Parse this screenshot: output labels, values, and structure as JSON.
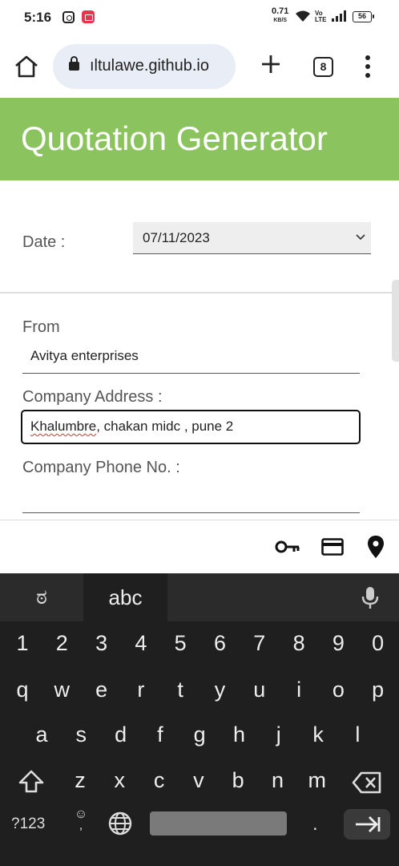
{
  "status_bar": {
    "time": "5:16",
    "net_speed": "0.71",
    "net_unit": "KB/S",
    "volte": "Vo LTE",
    "battery": "56"
  },
  "browser": {
    "url": "ıltulawe.github.io",
    "tab_count": "8"
  },
  "page": {
    "title": "Quotation Generator",
    "date_label": "Date :",
    "date_value": "07/11/2023",
    "from_label": "From",
    "from_value": "Avitya enterprises",
    "address_label": "Company Address :",
    "address_misspelled": "Khalumbre",
    "address_rest": ", chakan midc , pune 2",
    "phone_label": "Company Phone No. :"
  },
  "keyboard": {
    "lang_tab": "ಠ",
    "abc_tab": "abc",
    "number_row": [
      "1",
      "2",
      "3",
      "4",
      "5",
      "6",
      "7",
      "8",
      "9",
      "0"
    ],
    "row1": [
      "q",
      "w",
      "e",
      "r",
      "t",
      "y",
      "u",
      "i",
      "o",
      "p"
    ],
    "row2": [
      "a",
      "s",
      "d",
      "f",
      "g",
      "h",
      "j",
      "k",
      "l"
    ],
    "row3": [
      "z",
      "x",
      "c",
      "v",
      "b",
      "n",
      "m"
    ],
    "symbols_key": "?123",
    "emoji_comma": ",",
    "period_key": "."
  },
  "colors": {
    "banner": "#8bc45e",
    "keyboard_bg": "#1f1f1f",
    "url_bg": "#e9eef6"
  },
  "icons": [
    "instagram-icon",
    "screen-record-icon",
    "wifi-icon",
    "signal-icon",
    "battery-icon",
    "home-icon",
    "lock-icon",
    "plus-icon",
    "tabs-icon",
    "more-vert-icon",
    "chevron-down-icon",
    "key-icon",
    "credit-card-icon",
    "location-pin-icon",
    "mic-icon",
    "shift-icon",
    "backspace-icon",
    "emoji-icon",
    "globe-icon",
    "enter-icon"
  ]
}
